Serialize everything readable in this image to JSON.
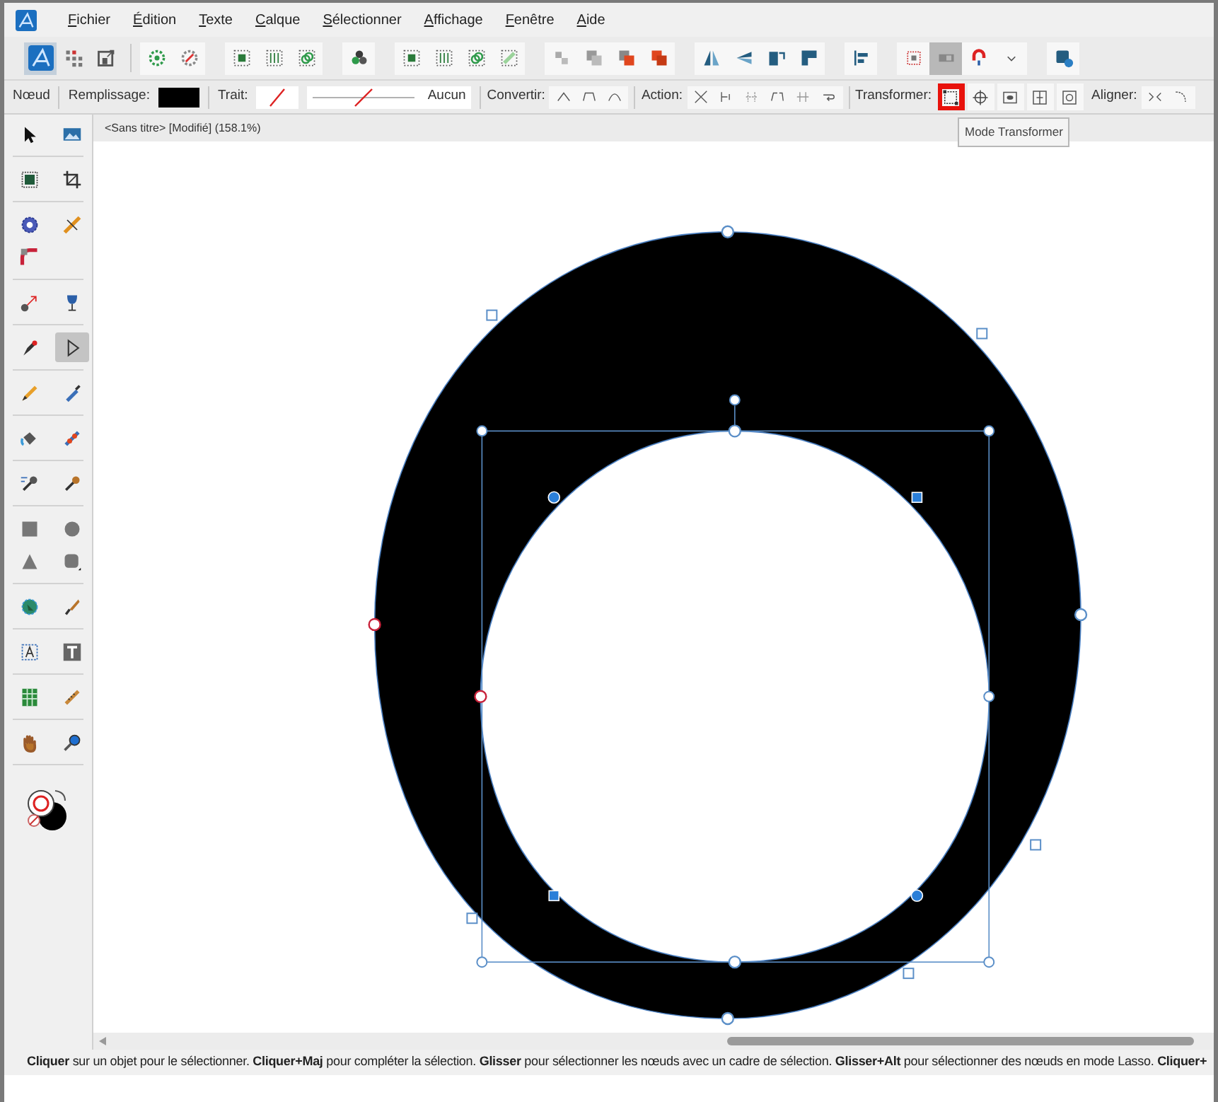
{
  "menu": [
    {
      "label": "Fichier"
    },
    {
      "label": "Édition"
    },
    {
      "label": "Texte"
    },
    {
      "label": "Calque"
    },
    {
      "label": "Sélectionner"
    },
    {
      "label": "Affichage"
    },
    {
      "label": "Fenêtre"
    },
    {
      "label": "Aide"
    }
  ],
  "toolbar_buttons": [
    {
      "selected": true
    },
    {
      "selected": false
    },
    {
      "selected": false
    },
    {
      "selected": false
    },
    {
      "selected": false
    },
    {
      "selected": false
    },
    {
      "selected": false
    },
    {
      "selected": false
    },
    {
      "selected": false
    },
    {
      "selected": false
    },
    {
      "selected": false
    },
    {
      "selected": false
    },
    {
      "selected": false
    },
    {
      "selected": false
    },
    {
      "selected": false
    },
    {
      "selected": false
    },
    {
      "selected": false
    },
    {
      "selected": false
    },
    {
      "selected": false
    },
    {
      "selected": false
    },
    {
      "selected": false
    },
    {
      "selected": false
    },
    {
      "selected": false
    },
    {
      "selected": true
    },
    {
      "selected": false
    },
    {
      "selected": false
    },
    {
      "selected": false
    }
  ],
  "context_toolbar": {
    "persona": "Nœud",
    "fill_label": "Remplissage:",
    "fill": {
      "color": "#000000"
    },
    "stroke_label": "Trait:",
    "stroke_width": "Aucun",
    "convert_label": "Convertir:",
    "action_label": "Action:",
    "transform_label": "Transformer:",
    "transform_modes": [
      {
        "selected": true
      },
      {
        "selected": false
      },
      {
        "selected": false
      },
      {
        "selected": false
      },
      {
        "selected": false
      }
    ],
    "align_label": "Aligner:"
  },
  "tooltip": "Mode Transformer",
  "document_tab": "<Sans titre> [Modifié] (158.1%)",
  "tools": [
    {
      "selected": false
    },
    {
      "selected": false
    },
    {
      "selected": false
    },
    {
      "selected": false
    },
    {
      "selected": false
    },
    {
      "selected": false
    },
    {
      "selected": false
    },
    {
      "selected": false
    },
    {
      "selected": false
    },
    {
      "selected": false
    },
    {
      "selected": true
    },
    {
      "selected": false
    },
    {
      "selected": false
    },
    {
      "selected": false
    },
    {
      "selected": false
    },
    {
      "selected": false
    },
    {
      "selected": false
    },
    {
      "selected": false
    },
    {
      "selected": false
    },
    {
      "selected": false
    },
    {
      "selected": false
    },
    {
      "selected": false
    },
    {
      "selected": false
    },
    {
      "selected": false
    },
    {
      "selected": false
    },
    {
      "selected": false
    },
    {
      "selected": false
    },
    {
      "selected": false
    },
    {
      "selected": false
    }
  ],
  "status_bar": "**Cliquer** sur un objet pour le sélectionner. **Cliquer+Maj** pour compléter la sélection. **Glisser** pour sélectionner les nœuds avec un cadre de sélection. **Glisser+Alt** pour sélectionner des nœuds en mode Lasso. **Cliquer+**"
}
